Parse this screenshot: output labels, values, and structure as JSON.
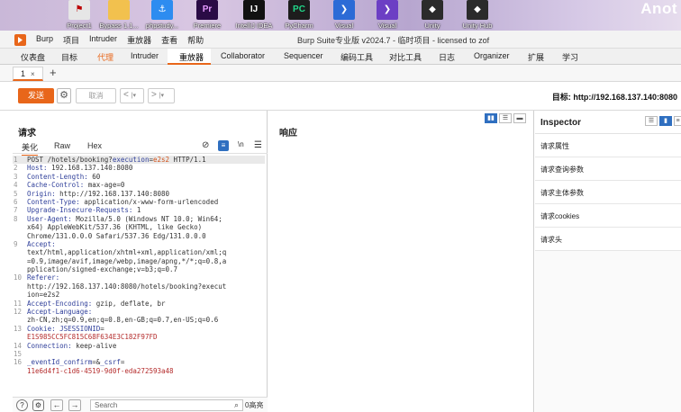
{
  "desktop": {
    "icons": [
      {
        "label": "Project1",
        "color": "#e6e6e6",
        "symbol": "⚑",
        "fg": "#b00"
      },
      {
        "label": "Bypass 1.1...",
        "color": "#f2c14e",
        "symbol": "",
        "fg": "#000"
      },
      {
        "label": "phpstudy...",
        "color": "#2d8cf0",
        "symbol": "⚓",
        "fg": "#fff"
      },
      {
        "label": "Premiere",
        "color": "#2a0b45",
        "symbol": "Pr",
        "fg": "#e59bff"
      },
      {
        "label": "IntelliJ IDEA",
        "color": "#111111",
        "symbol": "IJ",
        "fg": "#fff"
      },
      {
        "label": "PyCharm",
        "color": "#1d1d1d",
        "symbol": "PC",
        "fg": "#21d789"
      },
      {
        "label": "Visual",
        "color": "#2c6bd6",
        "symbol": "❯",
        "fg": "#fff"
      },
      {
        "label": "Visual",
        "color": "#6c3fc4",
        "symbol": "❯",
        "fg": "#fff"
      },
      {
        "label": "Unity",
        "color": "#2b2b2b",
        "symbol": "◆",
        "fg": "#fff"
      },
      {
        "label": "Unity Hub",
        "color": "#2b2b2b",
        "symbol": "◆",
        "fg": "#fff"
      }
    ],
    "brand_text": "Anot"
  },
  "titlebar": {
    "app": "Burp",
    "menu": [
      "项目",
      "Intruder",
      "重放器",
      "查看",
      "帮助"
    ],
    "title": "Burp Suite专业版  v2024.7 - 临时项目 - licensed to zof"
  },
  "main_tabs": [
    "仪表盘",
    "目标",
    "代理",
    "Intruder",
    "重放器",
    "Collaborator",
    "Sequencer",
    "编码工具",
    "对比工具",
    "日志",
    "Organizer",
    "扩展",
    "学习"
  ],
  "sub_tab": {
    "label": "1",
    "close": "×",
    "add": "+"
  },
  "toolbar": {
    "send": "发送",
    "cancel": "取消",
    "back": "<",
    "forward": ">",
    "target_label": "目标: http://192.168.137.140:8080"
  },
  "request": {
    "title": "请求",
    "tabs": [
      "美化",
      "Raw",
      "Hex"
    ],
    "icons": [
      "⊘",
      "≡",
      "\\n",
      "☰"
    ],
    "gutter": [
      "1",
      "2",
      "3",
      "4",
      "5",
      "6",
      "7",
      "8",
      "",
      "",
      "9",
      "",
      "",
      "",
      "10",
      "",
      "",
      "11",
      "12",
      "",
      "13",
      "",
      "14",
      "15",
      "16",
      ""
    ],
    "lines": [
      [
        {
          "t": "POST /hotels/booking?",
          "c": "s"
        },
        {
          "t": "execution",
          "c": "k"
        },
        {
          "t": "=",
          "c": "s"
        },
        {
          "t": "e2s2",
          "c": "p"
        },
        {
          "t": " HTTP/1.1",
          "c": "s"
        }
      ],
      [
        {
          "t": "Host: ",
          "c": "k"
        },
        {
          "t": "192.168.137.140:8080",
          "c": "s"
        }
      ],
      [
        {
          "t": "Content-Length: ",
          "c": "k"
        },
        {
          "t": "60",
          "c": "s"
        }
      ],
      [
        {
          "t": "Cache-Control: ",
          "c": "k"
        },
        {
          "t": "max-age=0",
          "c": "s"
        }
      ],
      [
        {
          "t": "Origin: ",
          "c": "k"
        },
        {
          "t": "http://192.168.137.140:8080",
          "c": "s"
        }
      ],
      [
        {
          "t": "Content-Type: ",
          "c": "k"
        },
        {
          "t": "application/x-www-form-urlencoded",
          "c": "s"
        }
      ],
      [
        {
          "t": "Upgrade-Insecure-Requests: ",
          "c": "k"
        },
        {
          "t": "1",
          "c": "s"
        }
      ],
      [
        {
          "t": "User-Agent: ",
          "c": "k"
        },
        {
          "t": "Mozilla/5.0 (Windows NT 10.0; Win64;",
          "c": "s"
        }
      ],
      [
        {
          "t": "x64) AppleWebKit/537.36 (KHTML, like Gecko)",
          "c": "s"
        }
      ],
      [
        {
          "t": "Chrome/131.0.0.0 Safari/537.36 Edg/131.0.0.0",
          "c": "s"
        }
      ],
      [
        {
          "t": "Accept:",
          "c": "k"
        }
      ],
      [
        {
          "t": "text/html,application/xhtml+xml,application/xml;q",
          "c": "s"
        }
      ],
      [
        {
          "t": "=0.9,image/avif,image/webp,image/apng,*/*;q=0.8,a",
          "c": "s"
        }
      ],
      [
        {
          "t": "pplication/signed-exchange;v=b3;q=0.7",
          "c": "s"
        }
      ],
      [
        {
          "t": "Referer:",
          "c": "k"
        }
      ],
      [
        {
          "t": "http://192.168.137.140:8080/hotels/booking?execut",
          "c": "s"
        }
      ],
      [
        {
          "t": "ion=e2s2",
          "c": "s"
        }
      ],
      [
        {
          "t": "Accept-Encoding: ",
          "c": "k"
        },
        {
          "t": "gzip, deflate, br",
          "c": "s"
        }
      ],
      [
        {
          "t": "Accept-Language:",
          "c": "k"
        }
      ],
      [
        {
          "t": "zh-CN,zh;q=0.9,en;q=0.8,en-GB;q=0.7,en-US;q=0.6",
          "c": "s"
        }
      ],
      [
        {
          "t": "Cookie: ",
          "c": "k"
        },
        {
          "t": "JSESSIONID",
          "c": "k"
        },
        {
          "t": "=",
          "c": "s"
        }
      ],
      [
        {
          "t": "E1S985CC5FC815C68F634E3C182F97FD",
          "c": "ck"
        }
      ],
      [
        {
          "t": "Connection: ",
          "c": "k"
        },
        {
          "t": "keep-alive",
          "c": "s"
        }
      ],
      [
        {
          "t": "",
          "c": "s"
        }
      ],
      [
        {
          "t": "_eventId_confirm",
          "c": "k"
        },
        {
          "t": "=&",
          "c": "s"
        },
        {
          "t": "_csrf",
          "c": "k"
        },
        {
          "t": "=",
          "c": "s"
        }
      ],
      [
        {
          "t": "11e6d4f1-c1d6-4519-9d0f-eda272593a48",
          "c": "ck"
        }
      ]
    ],
    "search_placeholder": "Search",
    "highlights": "0高亮"
  },
  "response": {
    "title": "响应"
  },
  "inspector": {
    "title": "Inspector",
    "sections": [
      "请求属性",
      "请求查询参数",
      "请求主体参数",
      "请求cookies",
      "请求头"
    ]
  }
}
